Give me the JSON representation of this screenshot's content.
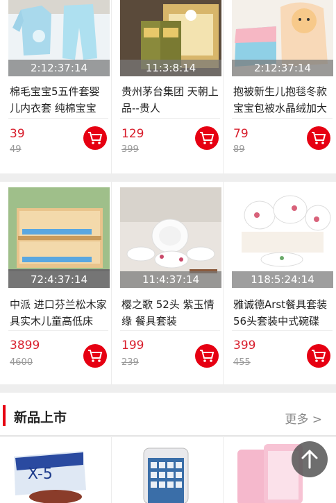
{
  "products_row1": [
    {
      "timer": "2:12:37:14",
      "title": "棉毛宝宝5五件套婴儿内衣套 纯棉宝宝",
      "price": "39",
      "old_price": "49"
    },
    {
      "timer": "11:3:8:14",
      "title": "贵州茅台集团 天朝上品--贵人",
      "price": "129",
      "old_price": "399"
    },
    {
      "timer": "2:12:37:14",
      "title": "抱被新生儿抱毯冬款宝宝包被水晶绒加大",
      "price": "79",
      "old_price": "89"
    }
  ],
  "products_row2": [
    {
      "timer": "72:4:37:14",
      "title": "中派 进口芬兰松木家具实木儿童高低床",
      "price": "3899",
      "old_price": "4600"
    },
    {
      "timer": "11:4:37:14",
      "title": "樱之歌 52头 紫玉情缘 餐具套装",
      "price": "199",
      "old_price": "239"
    },
    {
      "timer": "118:5:24:14",
      "title": "雅诚德Arst餐具套装56头套装中式碗碟",
      "price": "399",
      "old_price": "455"
    }
  ],
  "new_section": {
    "title": "新品上市",
    "more": "更多 >"
  },
  "icons": {
    "cart": "shopping-cart-icon",
    "back_to_top": "arrow-up-icon"
  },
  "colors": {
    "accent": "#e60012",
    "price": "#d81e2c"
  }
}
